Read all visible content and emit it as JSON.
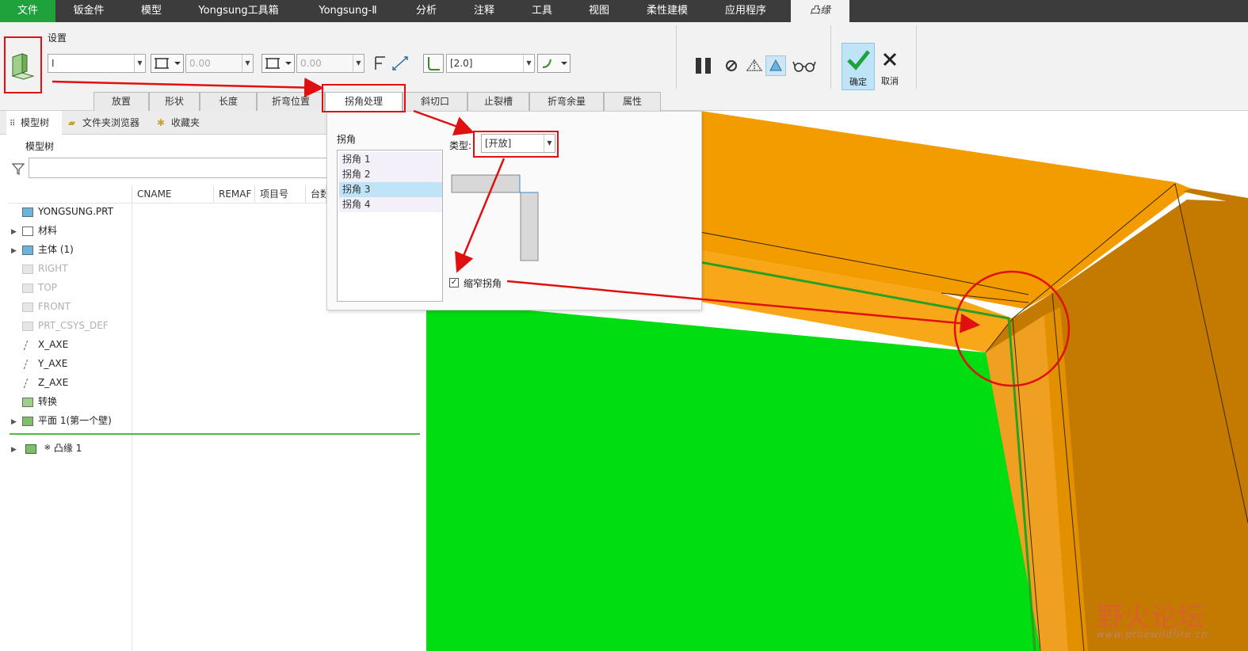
{
  "menu": {
    "items": [
      "文件",
      "钣金件",
      "模型",
      "Yongsung工具箱",
      "Yongsung-Ⅱ",
      "分析",
      "注释",
      "工具",
      "视图",
      "柔性建模",
      "应用程序",
      "凸缘"
    ]
  },
  "ribbon": {
    "settings_label": "设置",
    "shape_value": "I",
    "length1_value": "0.00",
    "length2_value": "0.00",
    "radius_value": "[2.0]",
    "tabs": [
      "放置",
      "形状",
      "长度",
      "折弯位置",
      "拐角处理",
      "斜切口",
      "止裂槽",
      "折弯余量",
      "属性"
    ],
    "ok_label": "确定",
    "cancel_label": "取消"
  },
  "navigator": {
    "tabs": [
      "模型树",
      "文件夹浏览器",
      "收藏夹"
    ],
    "tree_title": "模型树",
    "columns": [
      "CNAME",
      "REMAF",
      "项目号",
      "台数"
    ],
    "rows": [
      {
        "label": "YONGSUNG.PRT",
        "icon": "part-icon",
        "dim": false,
        "expand": ""
      },
      {
        "label": "材料",
        "icon": "material-icon",
        "dim": false,
        "expand": "▶"
      },
      {
        "label": "主体 (1)",
        "icon": "body-icon",
        "dim": false,
        "expand": "▶"
      },
      {
        "label": "RIGHT",
        "icon": "datum-plane-icon",
        "dim": true,
        "expand": ""
      },
      {
        "label": "TOP",
        "icon": "datum-plane-icon",
        "dim": true,
        "expand": ""
      },
      {
        "label": "FRONT",
        "icon": "datum-plane-icon",
        "dim": true,
        "expand": ""
      },
      {
        "label": "PRT_CSYS_DEF",
        "icon": "csys-icon",
        "dim": true,
        "expand": ""
      },
      {
        "label": "X_AXE",
        "icon": "axis-icon",
        "dim": false,
        "expand": ""
      },
      {
        "label": "Y_AXE",
        "icon": "axis-icon",
        "dim": false,
        "expand": ""
      },
      {
        "label": "Z_AXE",
        "icon": "axis-icon",
        "dim": false,
        "expand": ""
      },
      {
        "label": "转换",
        "icon": "convert-icon",
        "dim": false,
        "expand": ""
      },
      {
        "label": "平面 1(第一个壁)",
        "icon": "flat-wall-icon",
        "dim": false,
        "expand": "▶"
      }
    ],
    "insert_row": {
      "label": "凸缘 1",
      "marker": "※",
      "icon": "flange-icon",
      "expand": "▶"
    }
  },
  "corner_panel": {
    "group_label": "拐角",
    "items": [
      "拐角 1",
      "拐角 2",
      "拐角 3",
      "拐角 4"
    ],
    "selected_index": 2,
    "type_label": "类型:",
    "type_value": "[开放]",
    "checkbox_label": "缩窄拐角",
    "checkbox_checked": true
  },
  "watermark": {
    "title": "野火论坛",
    "url": "www.proewildfire.cn"
  },
  "colors": {
    "menubar": "#3c3c3c",
    "file_menu": "#1fa13b",
    "model_orange": "#f39c00",
    "model_dark_orange": "#c27800",
    "surface_green": "#00dd10",
    "annotation_red": "#e01010",
    "selection_blue": "#bfe3f7"
  }
}
